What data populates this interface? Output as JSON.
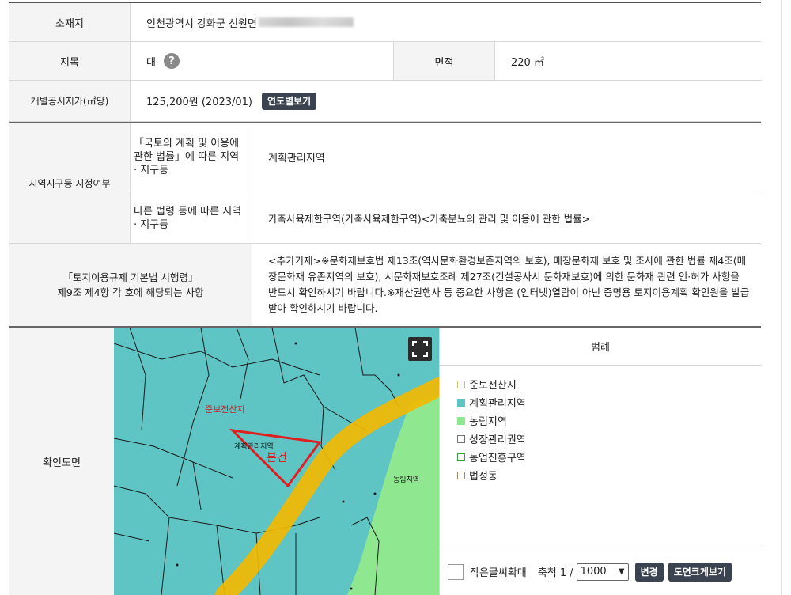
{
  "rows": {
    "address": {
      "label": "소재지",
      "value": "인천광역시 강화군 선원면"
    },
    "jimok": {
      "label": "지목",
      "value": "대",
      "help_icon": "?",
      "area_label": "면적",
      "area_value": "220 ㎡"
    },
    "price": {
      "label": "개별공시지가(㎡당)",
      "value": "125,200원 (2023/01)",
      "button": "연도별보기"
    },
    "zone": {
      "label": "지역지구등 지정여부",
      "sub1_label": "「국토의 계획 및 이용에 관한 법률」에 따른 지역 · 지구등",
      "sub1_value": "계획관리지역",
      "sub2_label": "다른 법령 등에 따른 지역 · 지구등",
      "sub2_value": "가축사육제한구역(가축사육제한구역)<가축분뇨의 관리 및 이용에 관한 법률>"
    },
    "enforcement": {
      "label_line1": "「토지이용규제 기본법 시행령」",
      "label_line2": "제9조 제4항 각 호에 해당되는 사항",
      "value": "<추가기재>※문화재보호법 제13조(역사문화환경보존지역의 보호), 매장문화재 보호 및 조사에 관한 법률 제4조(매장문화재 유존지역의 보호), 시문화재보호조례 제27조(건설공사시 문화재보호)에 의한 문화재 관련 인·허가 사항을 반드시 확인하시기 바랍니다.※재산권행사 등 중요한 사항은 (인터넷)열람이 아닌 증명용 토지이용계획 확인원을 발급 받아 확인하시기 바랍니다."
    },
    "map": {
      "label": "확인도면",
      "labels": {
        "jun": "준보전산지",
        "gye": "계획관리지역",
        "bon": "본건",
        "nong": "농림지역"
      }
    }
  },
  "legend": {
    "title": "범례",
    "items": [
      {
        "label": "준보전산지",
        "color": "#ffffff",
        "border": "#c9c96a"
      },
      {
        "label": "계획관리지역",
        "color": "#5ec4c4",
        "border": "#5ec4c4"
      },
      {
        "label": "농림지역",
        "color": "#8fe88f",
        "border": "#8fe88f"
      },
      {
        "label": "성장관리권역",
        "color": "#ffffff",
        "border": "#777777"
      },
      {
        "label": "농업진흥구역",
        "color": "#ffffff",
        "border": "#3ca03c"
      },
      {
        "label": "법정동",
        "color": "#ffffff",
        "border": "#a08a6a"
      }
    ],
    "small_font_label": "작은글씨확대",
    "scale_label": "축척 1 /",
    "scale_value": "1000",
    "change_button": "변경",
    "enlarge_button": "도면크게보기"
  },
  "colors": {
    "header_bg": "#f4f4f4",
    "button_dark": "#3c4350",
    "map_teal": "#5ec4c4",
    "map_green": "#8fe88f",
    "parcel_red": "#e02020",
    "highlight_yellow": "#f2b800"
  },
  "icons": {
    "fullscreen": "fullscreen-icon",
    "help": "question-icon",
    "dropdown": "chevron-down-icon"
  }
}
